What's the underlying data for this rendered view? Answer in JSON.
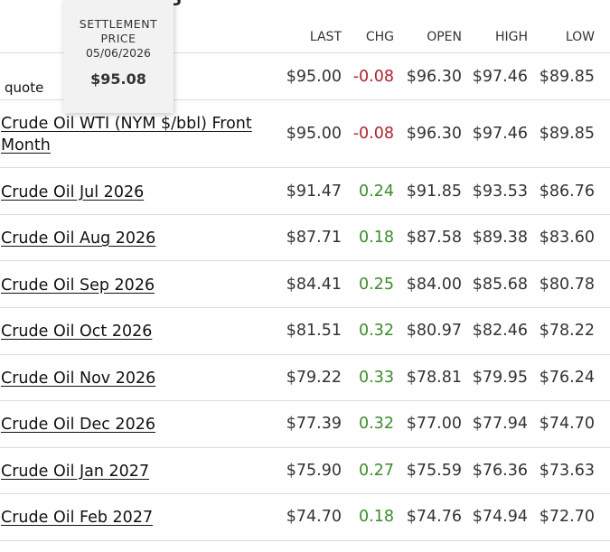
{
  "header": {
    "title_fragment": "S"
  },
  "settlement": {
    "label_line1": "SETTLEMENT",
    "label_line2": "PRICE",
    "date": "05/06/2026",
    "price": "$95.08"
  },
  "columns": {
    "last": "LAST",
    "chg": "CHG",
    "open": "OPEN",
    "high": "HIGH",
    "low": "LOW"
  },
  "quote_row": {
    "label": "quote",
    "last": "$95.00",
    "chg": "-0.08",
    "open": "$96.30",
    "high": "$97.46",
    "low": "$89.85"
  },
  "rows": [
    {
      "name": "Crude Oil WTI (NYM $/bbl) Front Month",
      "last": "$95.00",
      "chg": "-0.08",
      "open": "$96.30",
      "high": "$97.46",
      "low": "$89.85"
    },
    {
      "name": "Crude Oil Jul 2026",
      "last": "$91.47",
      "chg": "0.24",
      "open": "$91.85",
      "high": "$93.53",
      "low": "$86.76"
    },
    {
      "name": "Crude Oil Aug 2026",
      "last": "$87.71",
      "chg": "0.18",
      "open": "$87.58",
      "high": "$89.38",
      "low": "$83.60"
    },
    {
      "name": "Crude Oil Sep 2026",
      "last": "$84.41",
      "chg": "0.25",
      "open": "$84.00",
      "high": "$85.68",
      "low": "$80.78"
    },
    {
      "name": "Crude Oil Oct 2026",
      "last": "$81.51",
      "chg": "0.32",
      "open": "$80.97",
      "high": "$82.46",
      "low": "$78.22"
    },
    {
      "name": "Crude Oil Nov 2026",
      "last": "$79.22",
      "chg": "0.33",
      "open": "$78.81",
      "high": "$79.95",
      "low": "$76.24"
    },
    {
      "name": "Crude Oil Dec 2026",
      "last": "$77.39",
      "chg": "0.32",
      "open": "$77.00",
      "high": "$77.94",
      "low": "$74.70"
    },
    {
      "name": "Crude Oil Jan 2027",
      "last": "$75.90",
      "chg": "0.27",
      "open": "$75.59",
      "high": "$76.36",
      "low": "$73.63"
    },
    {
      "name": "Crude Oil Feb 2027",
      "last": "$74.70",
      "chg": "0.18",
      "open": "$74.76",
      "high": "$74.94",
      "low": "$72.70"
    }
  ],
  "colors": {
    "negative": "#b0222c",
    "positive": "#3e8a2e",
    "divider": "#dcdcdc"
  }
}
